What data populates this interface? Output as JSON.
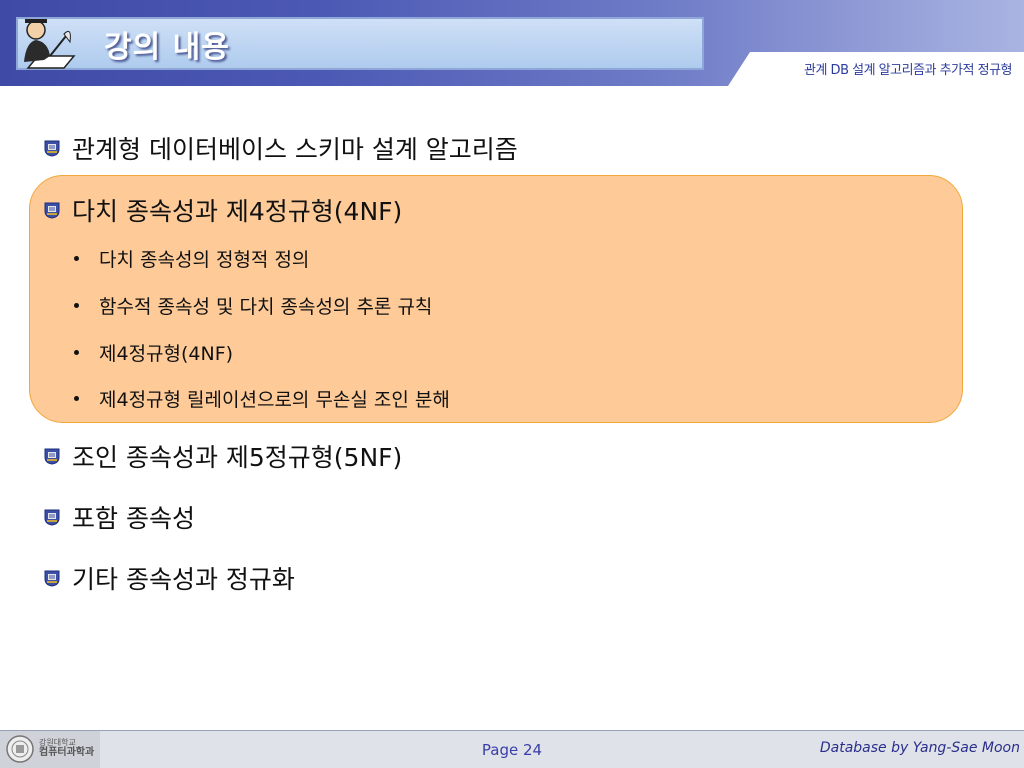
{
  "header": {
    "title": "강의 내용",
    "subtitle": "관계 DB 설계 알고리즘과 추가적 정규형"
  },
  "items": [
    {
      "label": "관계형 데이터베이스 스키마 설계 알고리즘"
    },
    {
      "label": "다치 종속성과 제4정규형(4NF)"
    },
    {
      "label": "조인 종속성과 제5정규형(5NF)"
    },
    {
      "label": "포함 종속성"
    },
    {
      "label": "기타 종속성과 정규화"
    }
  ],
  "sub_items": [
    {
      "label": "다치 종속성의 정형적 정의"
    },
    {
      "label": "함수적 종속성 및 다치 종속성의 추론 규칙"
    },
    {
      "label": "제4정규형(4NF)"
    },
    {
      "label": "제4정규형 릴레이션으로의 무손실 조인 분해"
    }
  ],
  "footer": {
    "university_line1": "강원대학교",
    "university_line2": "컴퓨터과학과",
    "page": "Page 24",
    "credit": "Database by Yang-Sae Moon"
  },
  "colors": {
    "header_band": "#3e4aa6",
    "highlight_fill": "#fecb98",
    "highlight_border": "#f0a83c",
    "footer_text": "#3a3ea8"
  }
}
